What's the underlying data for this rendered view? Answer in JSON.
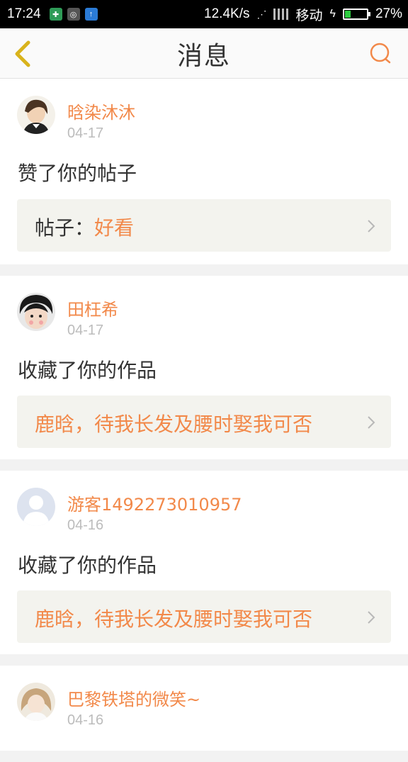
{
  "status_bar": {
    "time": "17:24",
    "speed": "12.4K/s",
    "carrier": "移动",
    "battery": "27%",
    "battery_level": 0.27
  },
  "header": {
    "title": "消息"
  },
  "messages": [
    {
      "username": "晗染沐沐",
      "date": "04-17",
      "action": "赞了你的帖子",
      "ref_prefix": "帖子：",
      "ref_title": "好看"
    },
    {
      "username": "田枉希",
      "date": "04-17",
      "action": "收藏了你的作品",
      "ref_prefix": "",
      "ref_title": "鹿晗，待我长发及腰时娶我可否"
    },
    {
      "username": "游客1492273010957",
      "date": "04-16",
      "action": "收藏了你的作品",
      "ref_prefix": "",
      "ref_title": "鹿晗，待我长发及腰时娶我可否"
    },
    {
      "username": "巴黎铁塔的微笑~",
      "date": "04-16"
    }
  ]
}
